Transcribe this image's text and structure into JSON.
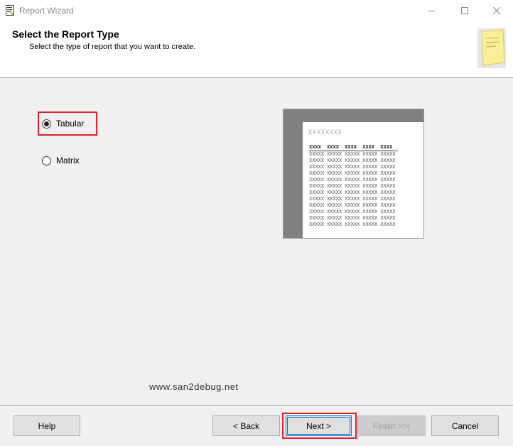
{
  "window": {
    "title": "Report Wizard",
    "icon": "report-wizard-icon",
    "controls": [
      "minimize-icon",
      "maximize-icon",
      "close-icon"
    ]
  },
  "header": {
    "title": "Select the Report Type",
    "subtitle": "Select the type of report that you want to create."
  },
  "report_types": {
    "selected": "Tabular",
    "options": [
      {
        "label": "Tabular",
        "checked": true
      },
      {
        "label": "Matrix",
        "checked": false
      }
    ]
  },
  "preview": {
    "title": "XXXXXXXX",
    "headers": [
      "XXXX",
      "XXXX",
      "XXXX",
      "XXXX",
      "XXXX"
    ],
    "cell": "XXXXX",
    "rows": 12
  },
  "watermark": "www.san2debug.net",
  "buttons": {
    "help": "Help",
    "back": "< Back",
    "next": "Next >",
    "finish": "Finish >>|",
    "cancel": "Cancel"
  },
  "colors": {
    "highlight": "#e0202a",
    "focus": "#0078d7",
    "background": "#f0f0f0"
  }
}
